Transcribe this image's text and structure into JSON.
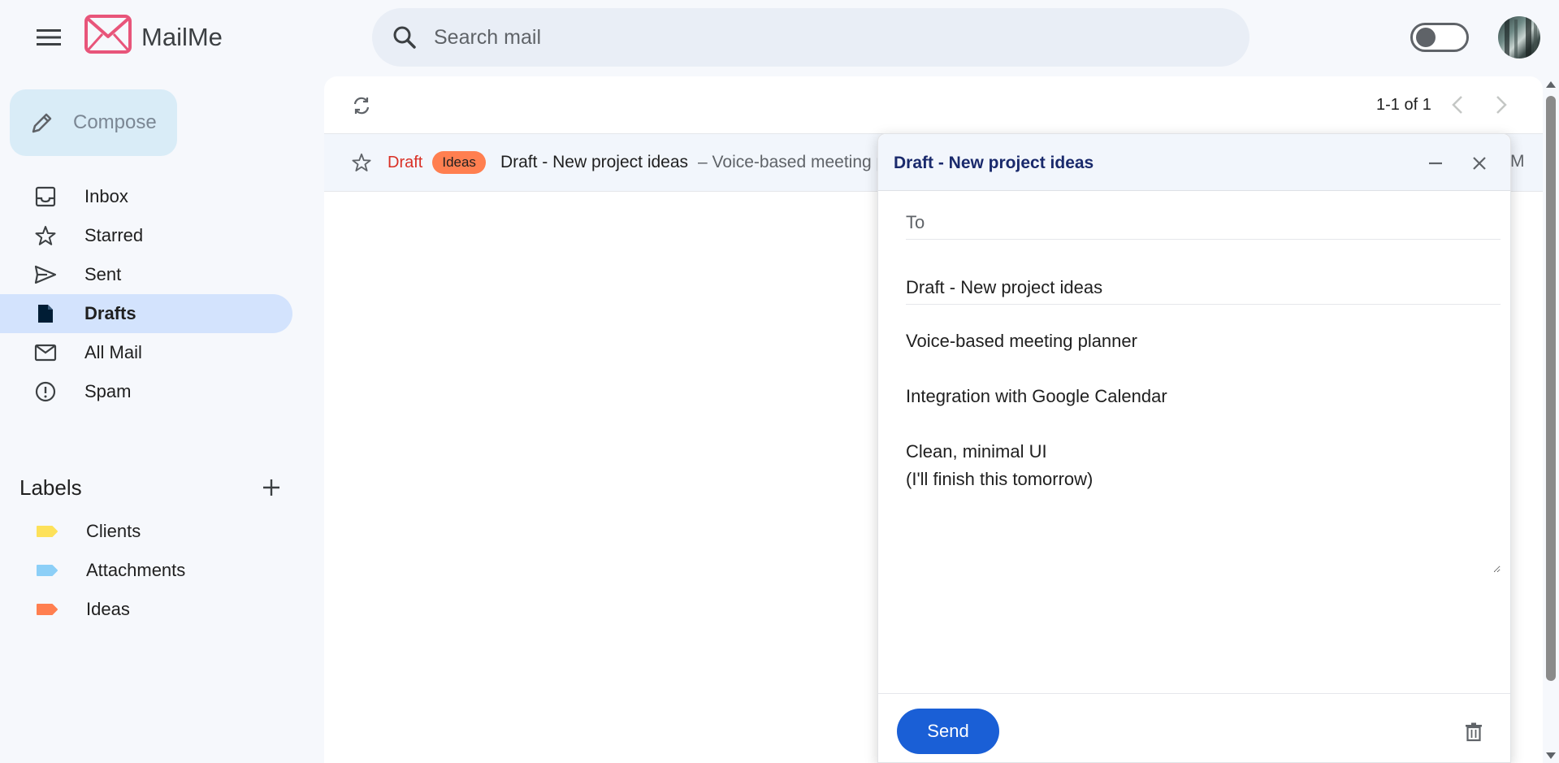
{
  "app": {
    "name": "MailMe"
  },
  "search": {
    "placeholder": "Search mail"
  },
  "compose": {
    "label": "Compose"
  },
  "nav": [
    {
      "label": "Inbox",
      "icon": "inbox-icon",
      "active": false
    },
    {
      "label": "Starred",
      "icon": "star-icon",
      "active": false
    },
    {
      "label": "Sent",
      "icon": "send-icon",
      "active": false
    },
    {
      "label": "Drafts",
      "icon": "draft-file-icon",
      "active": true
    },
    {
      "label": "All Mail",
      "icon": "mail-icon",
      "active": false
    },
    {
      "label": "Spam",
      "icon": "report-icon",
      "active": false
    }
  ],
  "labels": {
    "title": "Labels",
    "items": [
      {
        "label": "Clients",
        "color": "#fde15a"
      },
      {
        "label": "Attachments",
        "color": "#8ccff7"
      },
      {
        "label": "Ideas",
        "color": "#ff7f50"
      }
    ]
  },
  "list": {
    "pagination": "1-1 of 1",
    "rows": [
      {
        "status": "Draft",
        "badge": "Ideas",
        "badge_color": "#ff7f50",
        "subject": "Draft - New project ideas",
        "snippet": "– Voice-based meeting planner",
        "time": "M"
      }
    ]
  },
  "draft_window": {
    "title": "Draft - New project ideas",
    "to_placeholder": "To",
    "to_value": "",
    "subject_value": "Draft - New project ideas",
    "body": "Voice-based meeting planner\n\nIntegration with Google Calendar\n\nClean, minimal UI\n(I'll finish this tomorrow)",
    "send_label": "Send"
  },
  "colors": {
    "accent": "#1a5fd6",
    "active_nav": "#d3e3fd",
    "logo": "#e8557a",
    "draft_text": "#d93025"
  }
}
